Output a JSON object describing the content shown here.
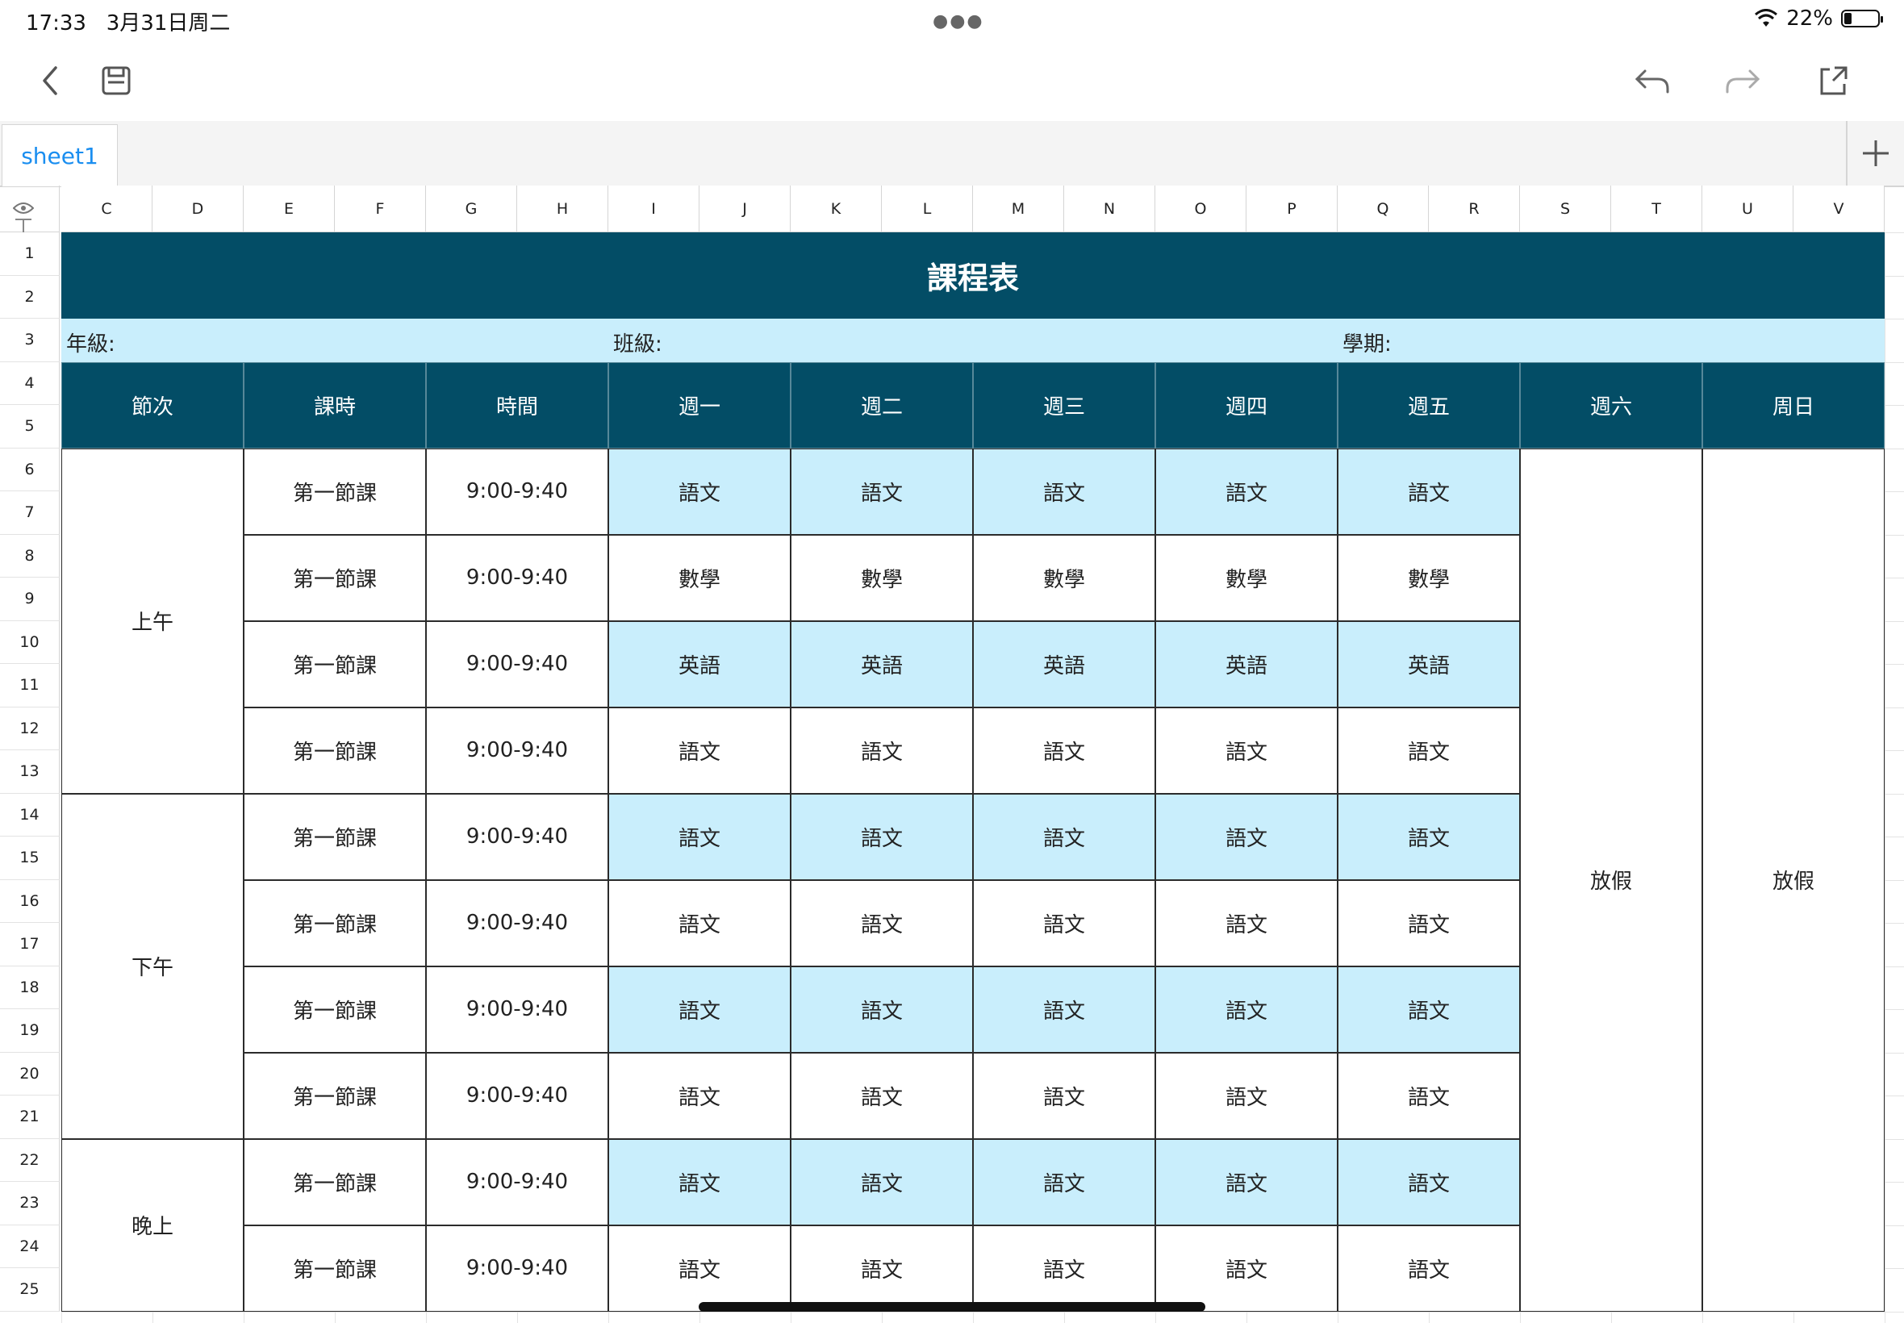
{
  "status_bar": {
    "time": "17:33",
    "date": "3月31日周二",
    "battery_percent": "22%",
    "battery_level": 0.22
  },
  "toolbar": {
    "back_icon": "chevron-left-icon",
    "save_icon": "save-icon",
    "undo_icon": "undo-icon",
    "redo_icon": "redo-icon",
    "share_icon": "share-icon"
  },
  "tabs": {
    "sheet_name": "sheet1",
    "add_label": "+"
  },
  "columns": [
    "C",
    "D",
    "E",
    "F",
    "G",
    "H",
    "I",
    "J",
    "K",
    "L",
    "M",
    "N",
    "O",
    "P",
    "Q",
    "R",
    "S",
    "T",
    "U",
    "V"
  ],
  "rows": [
    "1",
    "2",
    "3",
    "4",
    "5",
    "6",
    "7",
    "8",
    "9",
    "10",
    "11",
    "12",
    "13",
    "14",
    "15",
    "16",
    "17",
    "18",
    "19",
    "20",
    "21",
    "22",
    "23",
    "24",
    "25"
  ],
  "timetable": {
    "title": "課程表",
    "grade_label": "年級:",
    "class_label": "班級:",
    "term_label": "學期:",
    "headers": [
      "節次",
      "課時",
      "時間",
      "週一",
      "週二",
      "週三",
      "週四",
      "週五",
      "週六",
      "周日"
    ],
    "periods": [
      "上午",
      "下午",
      "晚上"
    ],
    "lessons": [
      {
        "session": "第一節課",
        "time": "9:00-9:40",
        "subjects": [
          "語文",
          "語文",
          "語文",
          "語文",
          "語文"
        ]
      },
      {
        "session": "第一節課",
        "time": "9:00-9:40",
        "subjects": [
          "數學",
          "數學",
          "數學",
          "數學",
          "數學"
        ]
      },
      {
        "session": "第一節課",
        "time": "9:00-9:40",
        "subjects": [
          "英語",
          "英語",
          "英語",
          "英語",
          "英語"
        ]
      },
      {
        "session": "第一節課",
        "time": "9:00-9:40",
        "subjects": [
          "語文",
          "語文",
          "語文",
          "語文",
          "語文"
        ]
      },
      {
        "session": "第一節課",
        "time": "9:00-9:40",
        "subjects": [
          "語文",
          "語文",
          "語文",
          "語文",
          "語文"
        ]
      },
      {
        "session": "第一節課",
        "time": "9:00-9:40",
        "subjects": [
          "語文",
          "語文",
          "語文",
          "語文",
          "語文"
        ]
      },
      {
        "session": "第一節課",
        "time": "9:00-9:40",
        "subjects": [
          "語文",
          "語文",
          "語文",
          "語文",
          "語文"
        ]
      },
      {
        "session": "第一節課",
        "time": "9:00-9:40",
        "subjects": [
          "語文",
          "語文",
          "語文",
          "語文",
          "語文"
        ]
      },
      {
        "session": "第一節課",
        "time": "9:00-9:40",
        "subjects": [
          "語文",
          "語文",
          "語文",
          "語文",
          "語文"
        ]
      },
      {
        "session": "第一節課",
        "time": "9:00-9:40",
        "subjects": [
          "語文",
          "語文",
          "語文",
          "語文",
          "語文"
        ]
      }
    ],
    "weekend_saturday": "放假",
    "weekend_sunday": "放假"
  },
  "colors": {
    "header_dark": "#034d66",
    "highlight": "#c9eefc",
    "accent_blue": "#1a8ef0"
  }
}
